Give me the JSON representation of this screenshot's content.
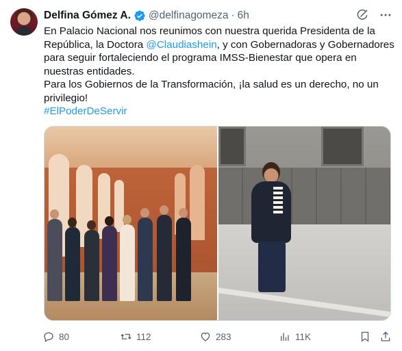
{
  "author": {
    "name": "Delfina Gómez A.",
    "handle": "@delfinagomeza",
    "separator": "·",
    "time": "6h"
  },
  "tweet": {
    "line1": "En Palacio Nacional nos reunimos con nuestra querida Presidenta de la",
    "line2_before": "República, la Doctora ",
    "line2_mention": "@Claudiashein",
    "line2_after": ", y con Gobernadoras y Gobernadores",
    "line3": "para seguir fortaleciendo el programa IMSS-Bienestar que opera en",
    "line4": "nuestras entidades.",
    "line5": "Para los Gobiernos de la Transformación, ¡la salud es un derecho, no un",
    "line6": "privilegio!",
    "hashtag": "#ElPoderDeServir"
  },
  "actions": {
    "replies": "80",
    "retweets": "112",
    "likes": "283",
    "views": "11K"
  },
  "icons": {
    "verified": "verified-badge-icon",
    "grok": "grok-icon",
    "more": "more-icon",
    "reply": "reply-icon",
    "retweet": "retweet-icon",
    "like": "heart-icon",
    "views": "views-icon",
    "bookmark": "bookmark-icon",
    "share": "share-icon"
  },
  "colors": {
    "link": "#1d9bf0",
    "secondary_text": "#536471",
    "verified": "#1d9bf0"
  }
}
